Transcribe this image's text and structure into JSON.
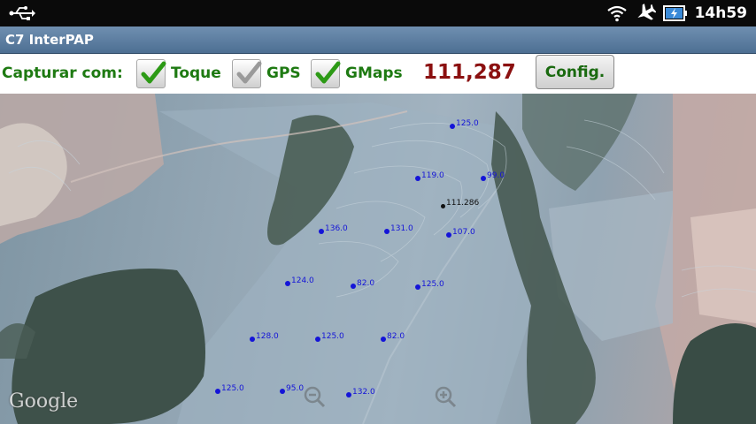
{
  "statusbar": {
    "time": "14h59",
    "icons": [
      "usb-icon",
      "wifi-icon",
      "airplane-icon",
      "battery-charging-icon"
    ]
  },
  "app": {
    "title": "C7 InterPAP"
  },
  "toolbar": {
    "capture_label": "Capturar com:",
    "options": [
      {
        "label": "Toque",
        "checked": true
      },
      {
        "label": "GPS",
        "checked": true,
        "dimmed": true
      },
      {
        "label": "GMaps",
        "checked": true
      }
    ],
    "counter": "111,287",
    "config_label": "Config."
  },
  "map": {
    "logo": "Google",
    "current": {
      "label": "111.286"
    },
    "points": [
      {
        "label": "125.0"
      },
      {
        "label": "119.0"
      },
      {
        "label": "99.0"
      },
      {
        "label": "136.0"
      },
      {
        "label": "131.0"
      },
      {
        "label": "107.0"
      },
      {
        "label": "124.0"
      },
      {
        "label": "82.0"
      },
      {
        "label": "125.0"
      },
      {
        "label": "128.0"
      },
      {
        "label": "125.0"
      },
      {
        "label": "82.0"
      },
      {
        "label": "125.0"
      },
      {
        "label": "95.0"
      },
      {
        "label": "132.0"
      }
    ],
    "colors": {
      "marker": "#1414d8",
      "current_marker": "#111111"
    }
  }
}
